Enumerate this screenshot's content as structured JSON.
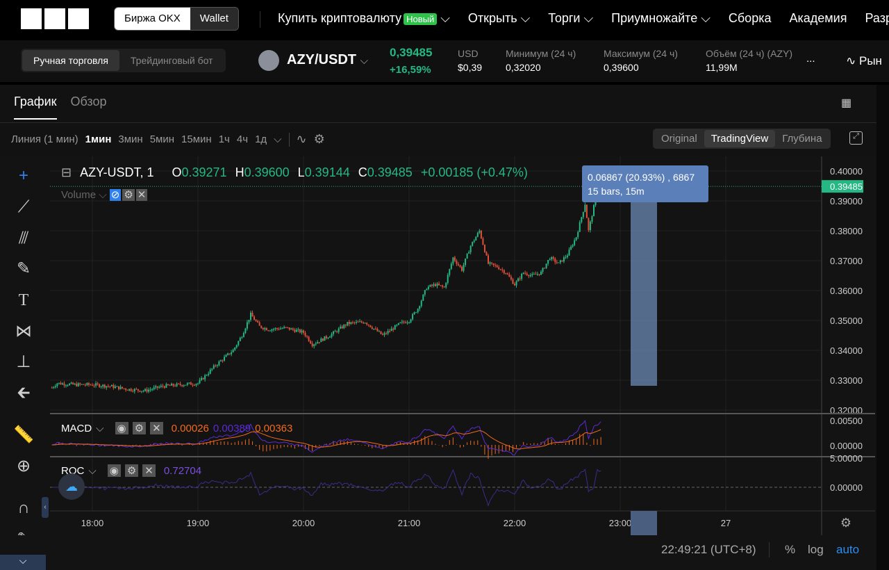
{
  "topnav": {
    "exchange_tab": "Биржа OKX",
    "wallet_tab": "Wallet",
    "items": [
      "Купить криптовалюту",
      "Открыть",
      "Торги",
      "Приумножайте",
      "Сборка",
      "Академия",
      "Разр"
    ],
    "new_badge": "Новый"
  },
  "ticker": {
    "modes": [
      "Ручная торговля",
      "Трейдинговый бот"
    ],
    "pair": "AZY/USDT",
    "price": "0,39485",
    "change": "+16,59%",
    "stats": [
      {
        "label": "USD",
        "value": "$0,39"
      },
      {
        "label": "Минимум (24 ч)",
        "value": "0,32020"
      },
      {
        "label": "Максимум (24 ч)",
        "value": "0,39600"
      },
      {
        "label": "Объём (24 ч) (AZY)",
        "value": "11,99M"
      }
    ],
    "more": "...",
    "market": "Рын"
  },
  "tabs": [
    "График",
    "Обзор"
  ],
  "timeframes": {
    "line": "Линия (1 мин)",
    "items": [
      "1мин",
      "3мин",
      "5мин",
      "15мин",
      "1ч",
      "4ч",
      "1д"
    ]
  },
  "views": [
    "Original",
    "TradingView",
    "Глубина"
  ],
  "legend": {
    "symbol": "AZY-USDT, 1",
    "o": "0.39271",
    "h": "0.39600",
    "l": "0.39144",
    "c": "0.39485",
    "chg": "+0.00185 (+0.47%)",
    "volume": "Volume"
  },
  "measure": {
    "line1": "0.06867 (20.93%) , 6867",
    "line2": "15 bars, 15m"
  },
  "price_axis": {
    "ticks": [
      "0.40000",
      "0.39000",
      "0.38000",
      "0.37000",
      "0.36000",
      "0.35000",
      "0.34000",
      "0.33000",
      "0.32000"
    ],
    "last": "0.39485"
  },
  "macd": {
    "label": "MACD",
    "v1": "0.00026",
    "v2": "0.00389",
    "v3": "0.00363",
    "ticks": [
      "0.00500",
      "0.00000"
    ]
  },
  "roc": {
    "label": "ROC",
    "value": "0.72704",
    "ticks": [
      "5.00000",
      "0.00000"
    ]
  },
  "time_axis": {
    "ticks": [
      "18:00",
      "19:00",
      "20:00",
      "21:00",
      "22:00",
      "23:00",
      "27"
    ]
  },
  "footer": {
    "clock": "22:49:21 (UTC+8)",
    "pct": "%",
    "log": "log",
    "auto": "auto"
  },
  "colors": {
    "up": "#25b884",
    "down": "#e1503b",
    "accent": "#2ec24a"
  },
  "chart_data": {
    "type": "candlestick",
    "note": "approximate close path, minutes after 17:00",
    "path": [
      [
        37,
        0.3275
      ],
      [
        40,
        0.329
      ],
      [
        50,
        0.3285
      ],
      [
        60,
        0.3285
      ],
      [
        70,
        0.328
      ],
      [
        80,
        0.327
      ],
      [
        90,
        0.3265
      ],
      [
        100,
        0.328
      ],
      [
        110,
        0.3285
      ],
      [
        120,
        0.329
      ],
      [
        125,
        0.332
      ],
      [
        130,
        0.335
      ],
      [
        140,
        0.34
      ],
      [
        145,
        0.345
      ],
      [
        150,
        0.352
      ],
      [
        155,
        0.348
      ],
      [
        160,
        0.347
      ],
      [
        170,
        0.3475
      ],
      [
        180,
        0.346
      ],
      [
        185,
        0.342
      ],
      [
        195,
        0.345
      ],
      [
        205,
        0.349
      ],
      [
        215,
        0.3495
      ],
      [
        225,
        0.345
      ],
      [
        235,
        0.349
      ],
      [
        240,
        0.35
      ],
      [
        245,
        0.354
      ],
      [
        250,
        0.361
      ],
      [
        255,
        0.362
      ],
      [
        260,
        0.361
      ],
      [
        265,
        0.371
      ],
      [
        270,
        0.367
      ],
      [
        275,
        0.375
      ],
      [
        280,
        0.38
      ],
      [
        285,
        0.369
      ],
      [
        290,
        0.368
      ],
      [
        295,
        0.366
      ],
      [
        300,
        0.362
      ],
      [
        305,
        0.366
      ],
      [
        310,
        0.365
      ],
      [
        315,
        0.366
      ],
      [
        320,
        0.371
      ],
      [
        325,
        0.369
      ],
      [
        330,
        0.372
      ],
      [
        335,
        0.378
      ],
      [
        340,
        0.389
      ],
      [
        342,
        0.38
      ],
      [
        345,
        0.388
      ],
      [
        349,
        0.3948
      ]
    ]
  }
}
